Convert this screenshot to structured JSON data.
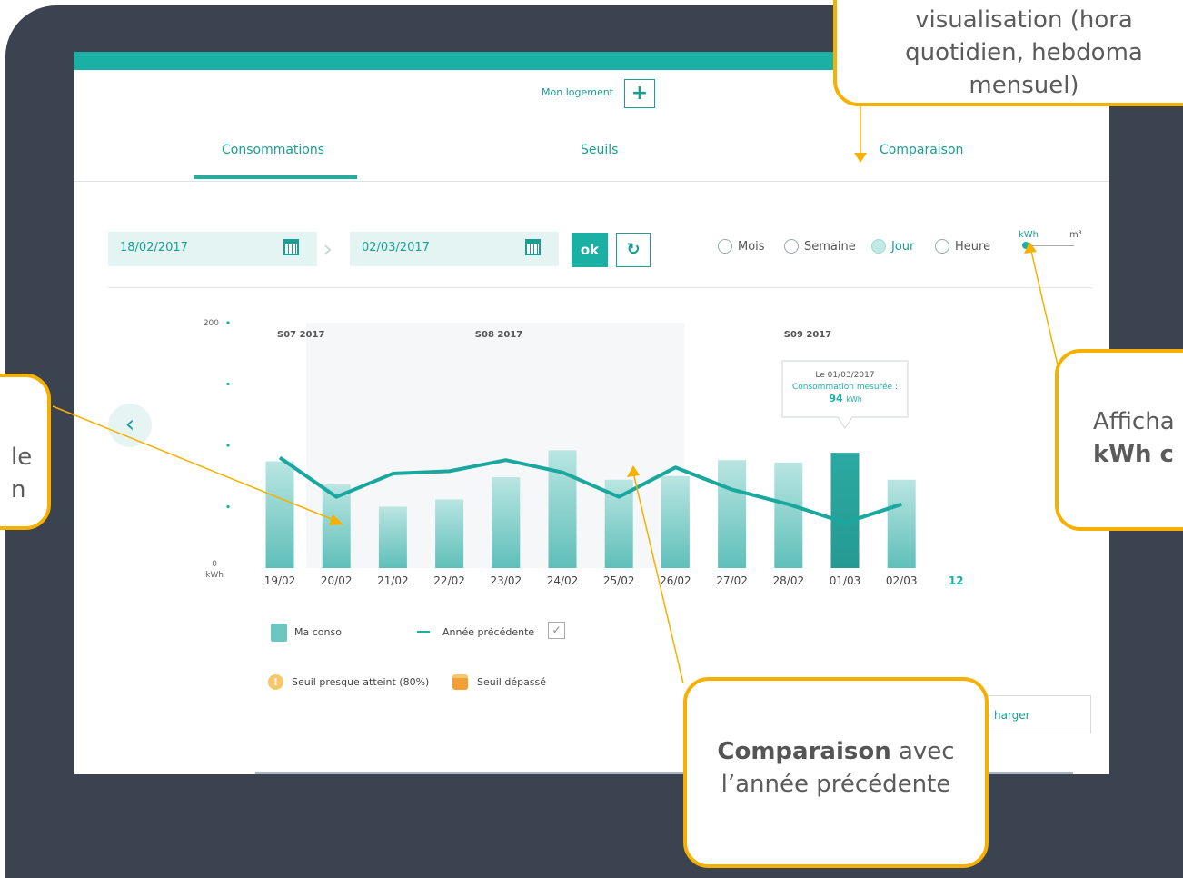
{
  "header": {
    "mon_logement": "Mon logement",
    "plus_label": "+"
  },
  "tabs": [
    {
      "label": "Consommations",
      "active": true
    },
    {
      "label": "Seuils"
    },
    {
      "label": "Comparaison"
    }
  ],
  "controls": {
    "start_date": "18/02/2017",
    "end_date": "02/03/2017",
    "ok_label": "ok",
    "refresh_icon": "refresh-icon",
    "periods": [
      {
        "label": "Mois"
      },
      {
        "label": "Semaine"
      },
      {
        "label": "Jour",
        "selected": true
      },
      {
        "label": "Heure"
      }
    ],
    "unit_kwh": "kWh",
    "unit_m3": "m³"
  },
  "chart_data": {
    "type": "bar",
    "week_labels": [
      "S07 2017",
      "S08 2017",
      "S09 2017"
    ],
    "categories": [
      "19/02",
      "20/02",
      "21/02",
      "22/02",
      "23/02",
      "24/02",
      "25/02",
      "26/02",
      "27/02",
      "28/02",
      "01/03",
      "02/03"
    ],
    "ylim": [
      0,
      200
    ],
    "y_ticks": [
      "200",
      "0"
    ],
    "y_unit": "kWh",
    "count_label": "12",
    "series": [
      {
        "name": "Ma conso",
        "type": "bar",
        "values": [
          87,
          68,
          50,
          56,
          74,
          96,
          72,
          75,
          88,
          86,
          94,
          72
        ],
        "highlighted_index": 10
      },
      {
        "name": "Année précédente",
        "type": "line",
        "values": [
          90,
          58,
          77,
          79,
          88,
          78,
          58,
          82,
          64,
          52,
          37,
          52
        ]
      }
    ],
    "tooltip": {
      "date_line": "Le 01/03/2017",
      "label": "Consommation mesurée :",
      "value": "94",
      "unit": "kWh"
    }
  },
  "legend": {
    "ma_conso": "Ma conso",
    "annee_precedente": "Année précédente",
    "seuil_presque": "Seuil presque atteint (80%)",
    "seuil_depasse": "Seuil dépassé"
  },
  "download_label": "harger",
  "callouts": {
    "top_line1": "visualisation (hora",
    "top_line2": "quotidien, hebdoma",
    "top_line3": "mensuel)",
    "right_line1": "Afficha",
    "right_line2": "kWh c",
    "left_line1": "le",
    "left_line2": "n",
    "bottom_bold": "Comparaison",
    "bottom_rest": " avec",
    "bottom_line2": "l’année précédente"
  },
  "colors": {
    "accent": "#1bb0a4",
    "callout_border": "#f5b000",
    "frame": "#3b4350"
  }
}
